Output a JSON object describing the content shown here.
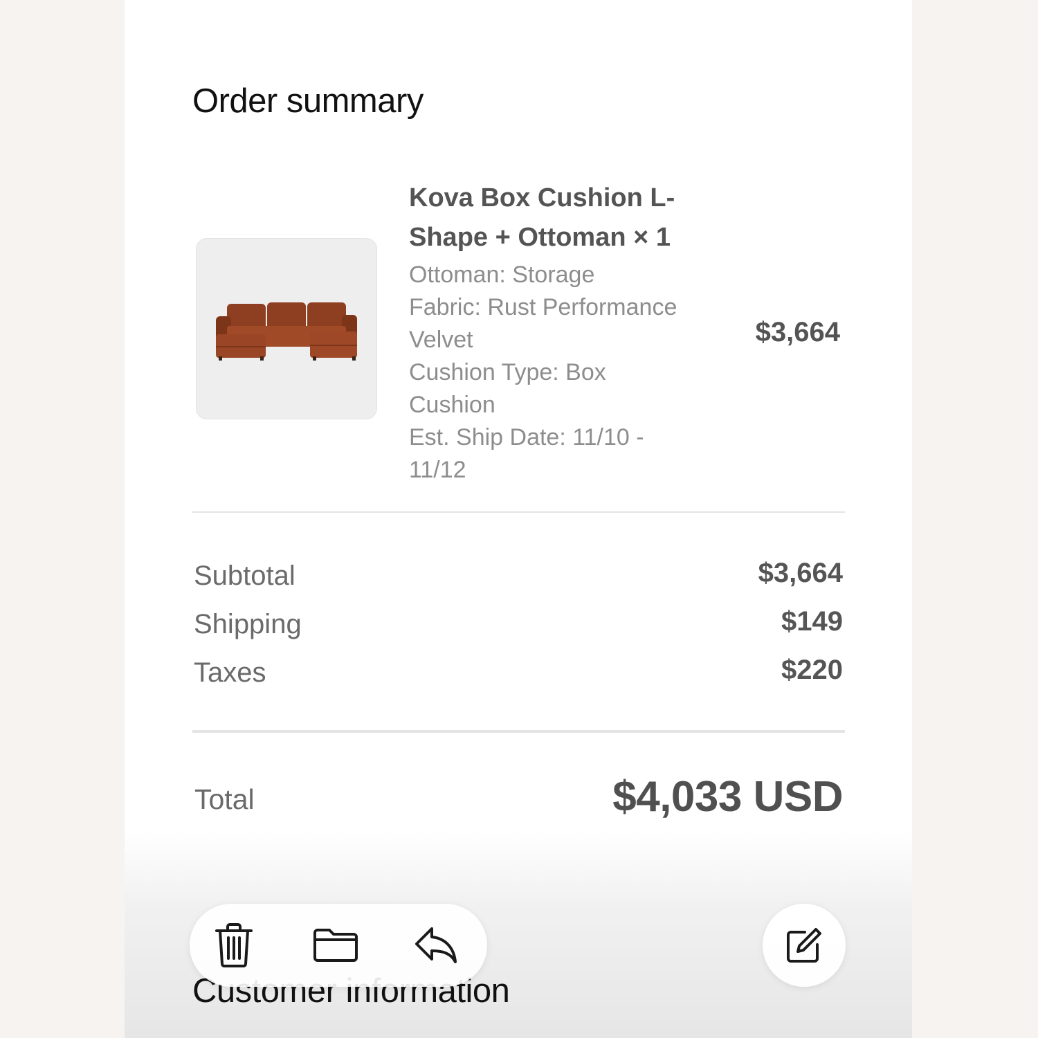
{
  "order_summary": {
    "heading": "Order summary",
    "item": {
      "image_alt": "sofa-image",
      "title_line1": "Kova Box Cushion L-",
      "title_line2": "Shape + Ottoman × 1",
      "details": [
        "Ottoman: Storage",
        "Fabric: Rust Performance",
        "Velvet",
        "Cushion Type: Box",
        "Cushion",
        "Est. Ship Date: 11/10 -",
        "11/12"
      ],
      "price": "$3,664",
      "image_color": "#9a4526"
    },
    "rows": [
      {
        "label": "Subtotal",
        "value": "$3,664"
      },
      {
        "label": "Shipping",
        "value": "$149"
      },
      {
        "label": "Taxes",
        "value": "$220"
      }
    ],
    "total": {
      "label": "Total",
      "value": "$4,033 USD"
    }
  },
  "customer_information": {
    "heading": "Customer information"
  },
  "toolbar": {
    "icons": [
      "trash-icon",
      "folder-icon",
      "reply-icon"
    ],
    "compose_icon": "compose-icon"
  }
}
